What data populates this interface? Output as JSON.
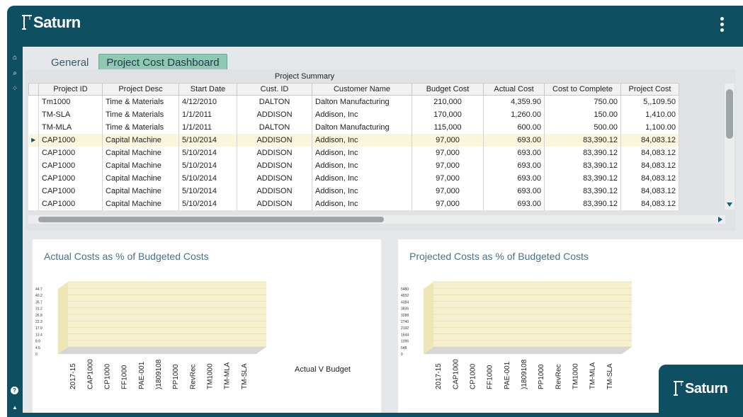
{
  "app": {
    "name": "Saturn"
  },
  "sidebar": {
    "icons": [
      {
        "name": "home-icon",
        "glyph": "⌂"
      },
      {
        "name": "search-icon",
        "glyph": "⌕"
      },
      {
        "name": "apps-grid-icon",
        "glyph": "⁘"
      }
    ],
    "bottom_icons": [
      {
        "name": "help-icon",
        "glyph": "?"
      },
      {
        "name": "bell-icon",
        "glyph": "▲"
      }
    ]
  },
  "tabs": [
    {
      "label": "General",
      "active": false
    },
    {
      "label": "Project Cost Dashboard",
      "active": true
    }
  ],
  "grid": {
    "title": "Project Summary",
    "columns": [
      "Project ID",
      "Project Desc",
      "Start Date",
      "Cust. ID",
      "Customer Name",
      "Budget Cost",
      "Actual Cost",
      "Cost to Complete",
      "Project Cost"
    ],
    "rows": [
      [
        "Tm1000",
        "Time & Materials",
        "4/12/2010",
        "DALTON",
        "Dalton Manufacturing",
        "210,000",
        "4,359.90",
        "750.00",
        "5,,109.50"
      ],
      [
        "TM-SLA",
        "Time & Materials",
        "1/1/2011",
        "ADDISON",
        "Addison, Inc",
        "170,000",
        "1,260.00",
        "150.00",
        "1,410.00"
      ],
      [
        "TM-MLA",
        "Time & Materials",
        "1/1/2011",
        "DALTON",
        "Dalton Manufacturing",
        "115,000",
        "600.00",
        "500.00",
        "1,100.00"
      ],
      [
        "CAP1000",
        "Capital Machine",
        "5/10/2014",
        "ADDISON",
        "Addison, Inc",
        "97,000",
        "693.00",
        "83,390.12",
        "84,083.12"
      ],
      [
        "CAP1000",
        "Capital Machine",
        "5/10/2014",
        "ADDISON",
        "Addison, Inc",
        "97,000",
        "693.00",
        "83,390.12",
        "84,083.12"
      ],
      [
        "CAP1000",
        "Capital Machine",
        "5/10/2014",
        "ADDISON",
        "Addison, Inc",
        "97,000",
        "693.00",
        "83,390.12",
        "84,083.12"
      ],
      [
        "CAP1000",
        "Capital Machine",
        "5/10/2014",
        "ADDISON",
        "Addison, Inc",
        "97,000",
        "693.00",
        "83,390.12",
        "84,083.12"
      ],
      [
        "CAP1000",
        "Capital Machine",
        "5/10/2014",
        "ADDISON",
        "Addison, Inc",
        "97,000",
        "693.00",
        "83,390.12",
        "84,083.12"
      ],
      [
        "CAP1000",
        "Capital Machine",
        "5/10/2014",
        "ADDISON",
        "Addison, Inc",
        "97,000",
        "693.00",
        "83,390.12",
        "84,083.12"
      ]
    ],
    "selected_row": 3
  },
  "charts": {
    "left": {
      "title": "Actual Costs as % of Budgeted Costs",
      "legend": "Actual V Budget",
      "color": "#c9c01c",
      "y_ticks": [
        "44.7",
        "40.2",
        "35.7",
        "31.2",
        "26.8",
        "22.3",
        "17.9",
        "13.4",
        "8.9",
        "4.5",
        "0"
      ],
      "categories": [
        "2017-15",
        "CAP1000",
        "CP1000",
        "FF1000",
        "PAE-001",
        ")1809108",
        "PP1000",
        "RevRec",
        "TM1000",
        "TM-MLA",
        "TM-SLA"
      ]
    },
    "right": {
      "title": "Projected Costs as % of Budgeted Costs",
      "color": "#a0451f",
      "y_ticks": [
        "5480",
        "4932",
        "4384",
        "3836",
        "3288",
        "2740",
        "2192",
        "1644",
        "1096",
        "548",
        "0"
      ],
      "categories": [
        "2017-15",
        "CAP1000",
        "CP1000",
        "FF1000",
        "PAE-001",
        ")1809108",
        "PP1000",
        "RevRec",
        "TM1000",
        "TM-MLA",
        "TM-SLA"
      ]
    }
  }
}
